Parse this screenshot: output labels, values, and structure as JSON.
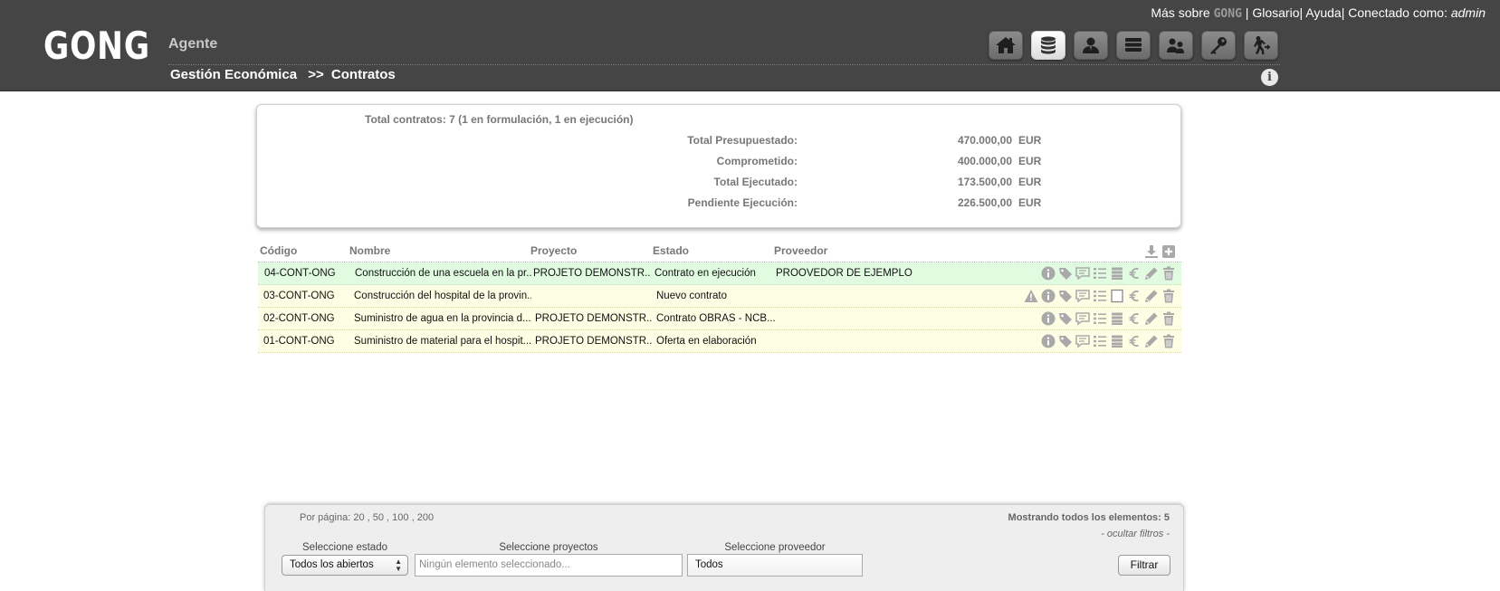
{
  "header": {
    "logo": "GONG",
    "section": "Agente",
    "top_links": {
      "mas_sobre": "Más sobre",
      "mini_logo": "GONG",
      "sep1": " | ",
      "glosario": "Glosario",
      "sep2": "| ",
      "ayuda": "Ayuda",
      "sep3": "| ",
      "connected_as": "Conectado como: ",
      "user": "admin"
    },
    "breadcrumb": {
      "item1": "Gestión Económica",
      "sep": ">>",
      "item2": "Contratos"
    },
    "nav_icons": [
      "home-icon",
      "database-icon",
      "user-icon",
      "books-icon",
      "users-icon",
      "key-icon",
      "exit-icon"
    ],
    "active_nav": "database-icon",
    "info": "i"
  },
  "summary": {
    "total_contracts": "Total contratos: 7 (1 en formulación, 1 en ejecución)",
    "rows": [
      {
        "label": "Total Presupuestado:",
        "value": "470.000,00",
        "currency": "EUR"
      },
      {
        "label": "Comprometido:",
        "value": "400.000,00",
        "currency": "EUR"
      },
      {
        "label": "Total Ejecutado:",
        "value": "173.500,00",
        "currency": "EUR"
      },
      {
        "label": "Pendiente Ejecución:",
        "value": "226.500,00",
        "currency": "EUR"
      }
    ]
  },
  "table": {
    "columns": {
      "codigo": "Código",
      "nombre": "Nombre",
      "proyecto": "Proyecto",
      "estado": "Estado",
      "proveedor": "Proveedor"
    },
    "rows": [
      {
        "codigo": "04-CONT-ONG",
        "nombre": "Construcción de una escuela en la pr...",
        "proyecto": "PROJETO DEMONSTR...",
        "estado": "Contrato en ejecución",
        "proveedor": "PROOVEDOR DE EJEMPLO"
      },
      {
        "codigo": "03-CONT-ONG",
        "nombre": "Construcción del hospital de la provin...",
        "proyecto": "",
        "estado": "Nuevo contrato",
        "proveedor": ""
      },
      {
        "codigo": "02-CONT-ONG",
        "nombre": "Suministro de agua en la provincia d...",
        "proyecto": "PROJETO DEMONSTR...",
        "estado": "Contrato OBRAS - NCB...",
        "proveedor": ""
      },
      {
        "codigo": "01-CONT-ONG",
        "nombre": "Suministro de material para el hospit...",
        "proyecto": "PROJETO DEMONSTR...",
        "estado": "Oferta en elaboración",
        "proveedor": ""
      }
    ]
  },
  "filters": {
    "per_page_label": "Por página:",
    "per_page_options": [
      "20",
      "50",
      "100",
      "200"
    ],
    "showing": "Mostrando todos los elementos: 5",
    "hide_filters": "- ocultar filtros -",
    "estado_label": "Seleccione estado",
    "estado_value": "Todos los abiertos",
    "proyectos_label": "Seleccione proyectos",
    "proyectos_placeholder": "Ningún elemento seleccionado...",
    "proveedor_label": "Seleccione proveedor",
    "proveedor_value": "Todos",
    "filter_button": "Filtrar"
  },
  "colors": {
    "header_bg": "#454545",
    "row_green": "#e1fbe1",
    "row_yellow": "#fefee4",
    "icon_gray": "#a9a9a9"
  }
}
